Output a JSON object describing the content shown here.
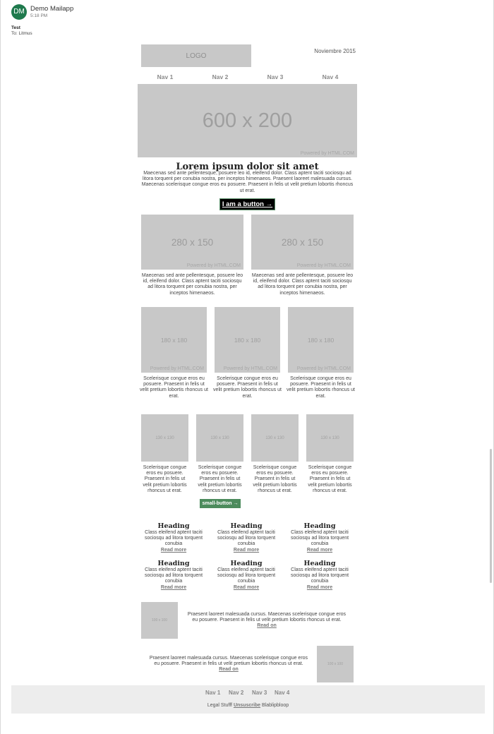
{
  "header": {
    "avatar_initials": "DM",
    "sender": "Demo Mailapp",
    "time": "5:18 PM",
    "subject": "Test",
    "to_label": "To:",
    "to": "Litmus"
  },
  "email": {
    "logo": "LOGO",
    "date": "Noviembre 2015",
    "nav": [
      "Nav 1",
      "Nav 2",
      "Nav 3",
      "Nav 4"
    ],
    "hero": {
      "label": "600 x 200",
      "powered": "Powered by HTML.COM"
    },
    "title": "Lorem ipsum dolor sit amet",
    "intro": "Maecenas sed ante pellentesque, posuere leo id, eleifend dolor. Class aptent taciti sociosqu ad litora torquent per conubia nostra, per inceptos himenaeos. Praesent laoreet malesuada cursus. Maecenas scelerisque congue eros eu posuere. Praesent in felis ut velit pretium lobortis rhoncus ut erat.",
    "button": "I am a button →",
    "two_col": [
      {
        "label": "280 x 150",
        "powered": "Powered by HTML.COM",
        "text": "Maecenas sed ante pellentesque, posuere leo id, eleifend dolor. Class aptent taciti sociosqu ad litora torquent per conubia nostra, per inceptos himenaeos."
      },
      {
        "label": "280 x 150",
        "powered": "Powered by HTML.COM",
        "text": "Maecenas sed ante pellentesque, posuere leo id, eleifend dolor. Class aptent taciti sociosqu ad litora torquent per conubia nostra, per inceptos himenaeos."
      }
    ],
    "three_col": [
      {
        "label": "180 x 180",
        "powered": "Powered by HTML.COM",
        "text": "Scelerisque congue eros eu posuere. Praesent in felis ut velit pretium lobortis rhoncus ut erat."
      },
      {
        "label": "180 x 180",
        "powered": "Powered by HTML.COM",
        "text": "Scelerisque congue eros eu posuere. Praesent in felis ut velit pretium lobortis rhoncus ut erat."
      },
      {
        "label": "180 x 180",
        "powered": "Powered by HTML.COM",
        "text": "Scelerisque congue eros eu posuere. Praesent in felis ut velit pretium lobortis rhoncus ut erat."
      }
    ],
    "four_col": [
      {
        "label": "130 x 130",
        "text": "Scelerisque congue eros eu posuere. Praesent in felis ut velit pretium lobortis rhoncus ut erat."
      },
      {
        "label": "130 x 130",
        "text": "Scelerisque congue eros eu posuere. Praesent in felis ut velit pretium lobortis rhoncus ut erat."
      },
      {
        "label": "130 x 130",
        "text": "Scelerisque congue eros eu posuere. Praesent in felis ut velit pretium lobortis rhoncus ut erat."
      },
      {
        "label": "130 x 130",
        "text": "Scelerisque congue eros eu posuere. Praesent in felis ut velit pretium lobortis rhoncus ut erat."
      }
    ],
    "small_button": "small-button →",
    "headings_rows": [
      [
        {
          "heading": "Heading",
          "text": "Class eleifend aptent taciti sociosqu ad litora torquent conubia",
          "link": "Read more"
        },
        {
          "heading": "Heading",
          "text": "Class eleifend aptent taciti sociosqu ad litora torquent conubia",
          "link": "Read more"
        },
        {
          "heading": "Heading",
          "text": "Class eleifend aptent taciti sociosqu ad litora torquent conubia",
          "link": "Read more"
        }
      ],
      [
        {
          "heading": "Heading",
          "text": "Class eleifend aptent taciti sociosqu ad litora torquent conubia",
          "link": "Read more"
        },
        {
          "heading": "Heading",
          "text": "Class eleifend aptent taciti sociosqu ad litora torquent conubia",
          "link": "Read more"
        },
        {
          "heading": "Heading",
          "text": "Class eleifend aptent taciti sociosqu ad litora torquent conubia",
          "link": "Read more"
        }
      ]
    ],
    "side_left": {
      "label": "100 x 100",
      "text": "Praesent laoreet malesuada cursus. Maecenas scelerisque congue eros eu posuere. Praesent in felis ut velit pretium lobortis rhoncus ut erat.",
      "link": "Read on"
    },
    "side_right": {
      "label": "100 x 100",
      "text": "Praesent laoreet malesuada cursus. Maecenas scelerisque congue eros eu posuere. Praesent in felis ut velit pretium lobortis rhoncus ut erat.",
      "link": "Read on"
    },
    "footer": {
      "nav": [
        "Nav 1",
        "Nav 2",
        "Nav 3",
        "Nav 4"
      ],
      "legal_prefix": "Legal Stufff",
      "unsubscribe": "Unsuscribe",
      "legal_suffix": "Blablipbloop"
    }
  },
  "colors": {
    "avatar": "#1f7a4d",
    "placeholder": "#c8c8c8",
    "button": "#000000",
    "small_button": "#4c8b5c",
    "footer_bg": "#ededed"
  }
}
